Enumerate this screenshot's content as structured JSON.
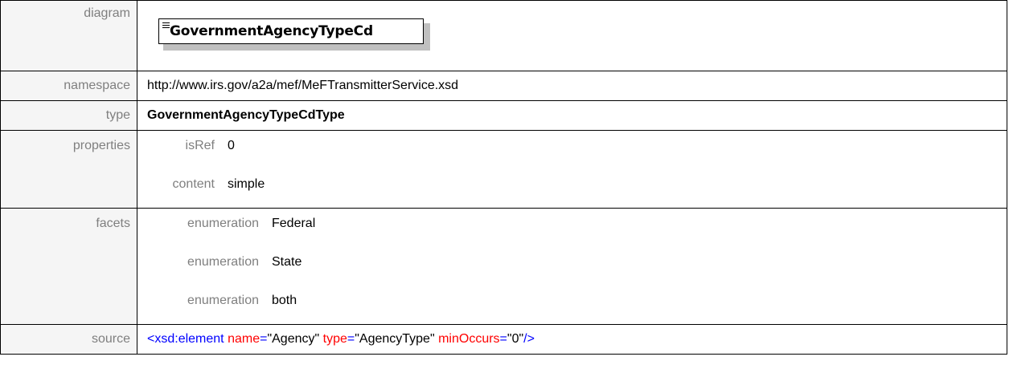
{
  "rows": {
    "diagram": {
      "label": "diagram",
      "element_name": "GovernmentAgencyTypeCd"
    },
    "namespace": {
      "label": "namespace",
      "value": "http://www.irs.gov/a2a/mef/MeFTransmitterService.xsd"
    },
    "type": {
      "label": "type",
      "value": "GovernmentAgencyTypeCdType"
    },
    "properties": {
      "label": "properties",
      "items": [
        {
          "key": "isRef",
          "value": "0"
        },
        {
          "key": "content",
          "value": "simple"
        }
      ]
    },
    "facets": {
      "label": "facets",
      "items": [
        {
          "key": "enumeration",
          "value": "Federal"
        },
        {
          "key": "enumeration",
          "value": "State"
        },
        {
          "key": "enumeration",
          "value": "both"
        }
      ]
    },
    "source": {
      "label": "source",
      "open": "<",
      "tag": "xsd:element",
      "attr1_name": "name",
      "eq": "=",
      "attr1_value": "\"Agency\"",
      "attr2_name": "type",
      "attr2_value": "\"AgencyType\"",
      "attr3_name": "minOccurs",
      "attr3_value": "\"0\"",
      "close": "/>"
    }
  },
  "colors": {
    "label_text": "#7f7f7f",
    "label_bg": "#f5f5f5",
    "xml_tag": "#0000ff",
    "xml_attr": "#ff0000"
  }
}
